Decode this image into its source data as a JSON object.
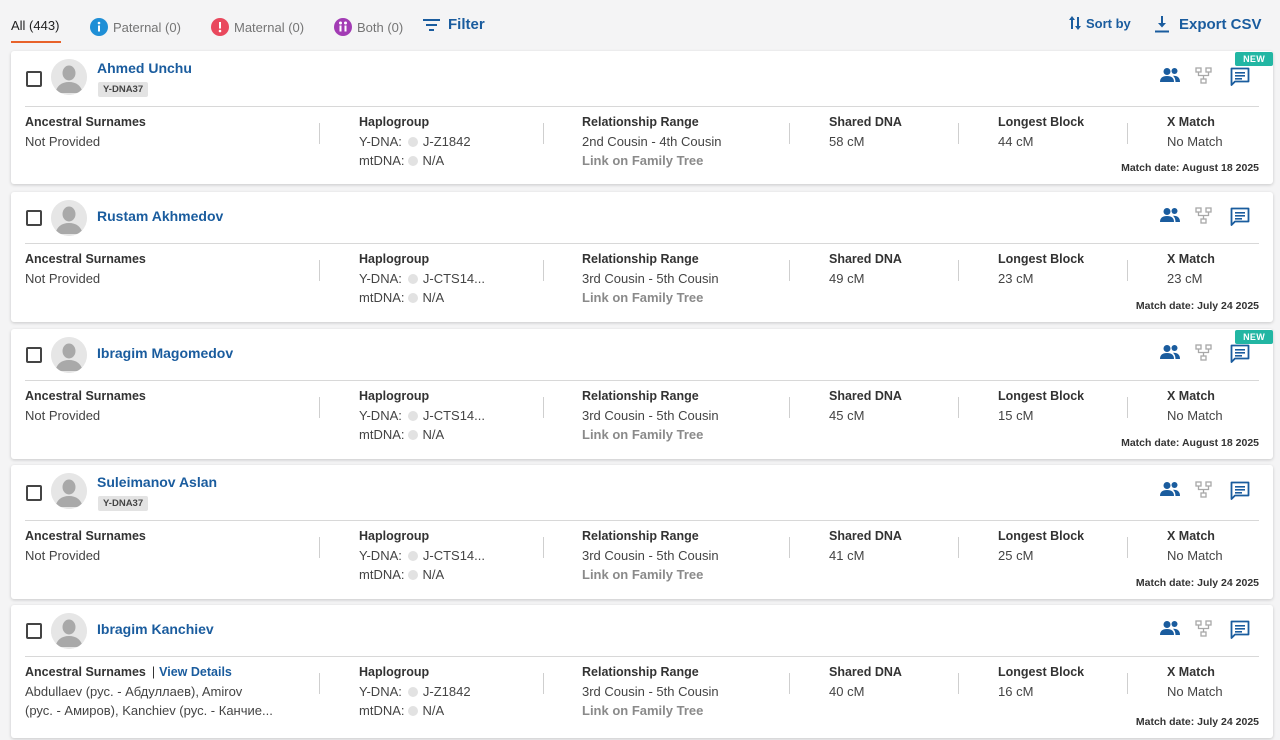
{
  "tabs": [
    {
      "label": "All (443)",
      "active": true
    },
    {
      "label": "Paternal (0)",
      "active": false
    },
    {
      "label": "Maternal (0)",
      "active": false
    },
    {
      "label": "Both (0)",
      "active": false
    }
  ],
  "toolbar": {
    "filter_label": "Filter",
    "sort_label": "Sort by",
    "export_label": "Export CSV"
  },
  "colors": {
    "link": "#1a5c9e",
    "accent": "#e8622a",
    "paternal": "#1f8fd6",
    "maternal": "#e9485d",
    "both": "#a23bb4",
    "new_badge": "#22b6a3"
  },
  "labels": {
    "ancestral_surnames": "Ancestral Surnames",
    "haplogroup": "Haplogroup",
    "relationship_range": "Relationship Range",
    "shared_dna": "Shared DNA",
    "longest_block": "Longest Block",
    "x_match": "X Match",
    "ydna": "Y-DNA:",
    "mtdna": "mtDNA:",
    "link_tree": "Link on Family Tree",
    "view_details": "View Details",
    "new_badge": "NEW"
  },
  "matches": [
    {
      "name": "Ahmed Unchu",
      "tag": "Y-DNA37",
      "is_new": true,
      "surnames_1": "Not Provided",
      "surnames_2": "",
      "ydna": "J-Z1842",
      "mtdna": "N/A",
      "relationship": "2nd Cousin - 4th Cousin",
      "shared_dna": "58 cM",
      "longest_block": "44 cM",
      "x_match": "No Match",
      "match_date": "Match date: August 18 2025"
    },
    {
      "name": "Rustam Akhmedov",
      "tag": "",
      "is_new": false,
      "surnames_1": "Not Provided",
      "surnames_2": "",
      "ydna": "J-CTS14...",
      "mtdna": "N/A",
      "relationship": "3rd Cousin - 5th Cousin",
      "shared_dna": "49 cM",
      "longest_block": "23 cM",
      "x_match": "23 cM",
      "match_date": "Match date: July 24 2025"
    },
    {
      "name": "Ibragim Magomedov",
      "tag": "",
      "is_new": true,
      "surnames_1": "Not Provided",
      "surnames_2": "",
      "ydna": "J-CTS14...",
      "mtdna": "N/A",
      "relationship": "3rd Cousin - 5th Cousin",
      "shared_dna": "45 cM",
      "longest_block": "15 cM",
      "x_match": "No Match",
      "match_date": "Match date: August 18 2025"
    },
    {
      "name": "Suleimanov Aslan",
      "tag": "Y-DNA37",
      "is_new": false,
      "surnames_1": "Not Provided",
      "surnames_2": "",
      "ydna": "J-CTS14...",
      "mtdna": "N/A",
      "relationship": "3rd Cousin - 5th Cousin",
      "shared_dna": "41 cM",
      "longest_block": "25 cM",
      "x_match": "No Match",
      "match_date": "Match date: July 24 2025"
    },
    {
      "name": "Ibragim Kanchiev",
      "tag": "",
      "is_new": false,
      "surnames_1": "Abdullaev (рус. - Абдуллаев), Amirov",
      "surnames_2": "(рус. - Амиров), Kanchiev (рус. - Канчие...",
      "ydna": "J-Z1842",
      "mtdna": "N/A",
      "relationship": "3rd Cousin - 5th Cousin",
      "shared_dna": "40 cM",
      "longest_block": "16 cM",
      "x_match": "No Match",
      "match_date": "Match date: July 24 2025"
    }
  ]
}
